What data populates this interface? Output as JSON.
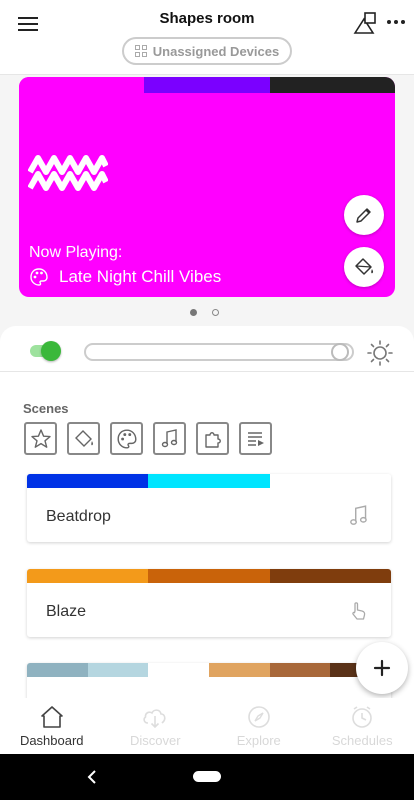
{
  "header": {
    "title": "Shapes room",
    "unassigned_label": "Unassigned Devices"
  },
  "now_playing": {
    "label": "Now Playing:",
    "track": "Late Night Chill Vibes",
    "background": "#ff00ff",
    "palette": [
      "#ff00ff",
      "#7b00ff",
      "#222222"
    ]
  },
  "carousel": {
    "pages": 2,
    "active": 1
  },
  "controls": {
    "power_on": true,
    "brightness": 0.98
  },
  "scenes": {
    "label": "Scenes",
    "filters": [
      "star-icon",
      "paint-bucket-icon",
      "palette-icon",
      "music-note-icon",
      "puzzle-icon",
      "playlist-icon"
    ],
    "items": [
      {
        "name": "Beatdrop",
        "icon": "music-note-icon",
        "palette": [
          "#0032e6",
          "#00e5ff",
          "#ffffff"
        ]
      },
      {
        "name": "Blaze",
        "icon": "touch-icon",
        "palette": [
          "#f39a1a",
          "#c9630a",
          "#7f3d0d"
        ]
      },
      {
        "name": "",
        "icon": "",
        "palette": [
          "#8fb2c0",
          "#b5d6e0",
          "#ffffff",
          "#e0a460",
          "#a8683a",
          "#5a3218"
        ]
      }
    ]
  },
  "nav": [
    {
      "label": "Dashboard",
      "icon": "home-icon",
      "active": true
    },
    {
      "label": "Discover",
      "icon": "cloud-download-icon",
      "active": false
    },
    {
      "label": "Explore",
      "icon": "compass-icon",
      "active": false
    },
    {
      "label": "Schedules",
      "icon": "clock-icon",
      "active": false
    }
  ]
}
